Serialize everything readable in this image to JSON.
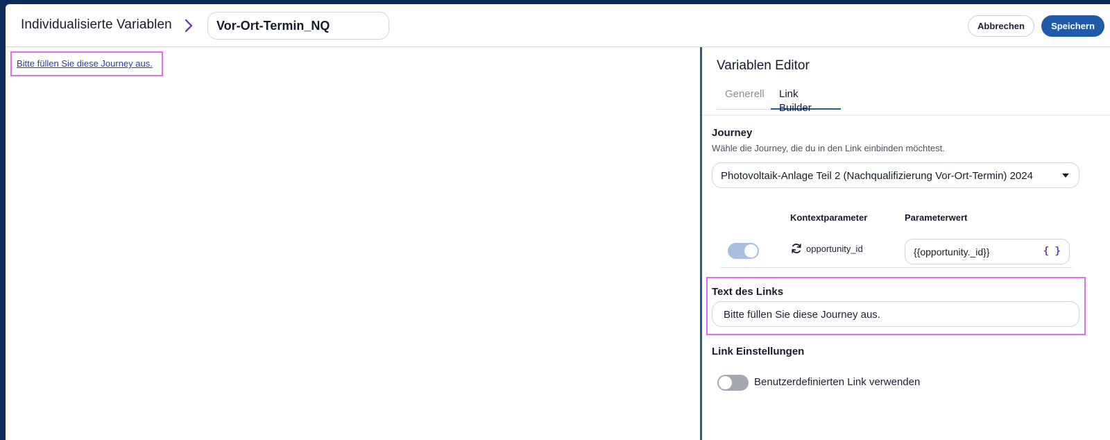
{
  "header": {
    "title": "Individualisierte Variablen",
    "name_value": "Vor-Ort-Termin_NQ",
    "cancel_label": "Abbrechen",
    "save_label": "Speichern"
  },
  "preview": {
    "link_text": "Bitte füllen Sie diese Journey aus."
  },
  "panel": {
    "title": "Variablen Editor",
    "tabs": [
      {
        "label": "Generell",
        "active": false
      },
      {
        "label": "Link Builder",
        "active": true
      }
    ],
    "journey": {
      "label": "Journey",
      "hint": "Wähle die Journey, die du in den Link einbinden möchtest.",
      "selected": "Photovoltaik-Anlage Teil 2 (Nachqualifizierung Vor-Ort-Termin) 2024"
    },
    "params": {
      "col_context": "Kontextparameter",
      "col_value": "Parameterwert",
      "rows": [
        {
          "enabled": true,
          "name": "opportunity_id",
          "value": "{{opportunity._id}}",
          "icon": "sync-icon"
        }
      ]
    },
    "link_text": {
      "label": "Text des Links",
      "value": "Bitte füllen Sie diese Journey aus."
    },
    "link_settings": {
      "label": "Link Einstellungen",
      "custom_link_label": "Benutzerdefinierten Link verwenden",
      "custom_link_enabled": false
    }
  },
  "colors": {
    "accent": "#1f5ba8",
    "highlight": "#e86be8",
    "link": "#2b3aa8"
  }
}
